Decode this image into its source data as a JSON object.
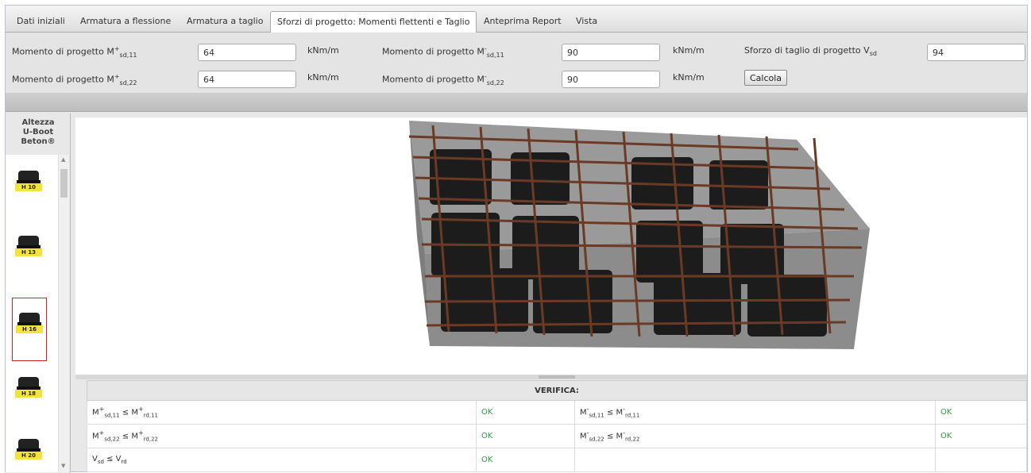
{
  "tabs": [
    {
      "label": "Dati iniziali"
    },
    {
      "label": "Armatura a flessione"
    },
    {
      "label": "Armatura a taglio"
    },
    {
      "label": "Sforzi di progetto: Momenti flettenti e Taglio"
    },
    {
      "label": "Anteprima Report"
    },
    {
      "label": "Vista"
    }
  ],
  "inputs": {
    "m_plus_11": {
      "label": "Momento di progetto M",
      "value": "64",
      "unit": "kNm/m"
    },
    "m_plus_22": {
      "label": "Momento di progetto M",
      "value": "64",
      "unit": "kNm/m"
    },
    "m_minus_11": {
      "label": "Momento di progetto M",
      "value": "90",
      "unit": "kNm/m"
    },
    "m_minus_22": {
      "label": "Momento di progetto M",
      "value": "90",
      "unit": "kNm/m"
    },
    "v_sd": {
      "label": "Sforzo di taglio di progetto V",
      "value": "94"
    },
    "calcola_label": "Calcola"
  },
  "sidebar": {
    "title_line1": "Altezza",
    "title_line2": "U-Boot",
    "title_line3": "Beton®",
    "items": [
      {
        "label": "H 10"
      },
      {
        "label": "H 13"
      },
      {
        "label": "H 16",
        "selected": true
      },
      {
        "label": "H 18"
      },
      {
        "label": "H 20"
      }
    ]
  },
  "verifica": {
    "title": "VERIFICA:",
    "rows": [
      {
        "left_status": "OK",
        "right_status": "OK"
      },
      {
        "left_status": "OK",
        "right_status": "OK"
      },
      {
        "left_status": "OK",
        "right_status": ""
      }
    ]
  }
}
